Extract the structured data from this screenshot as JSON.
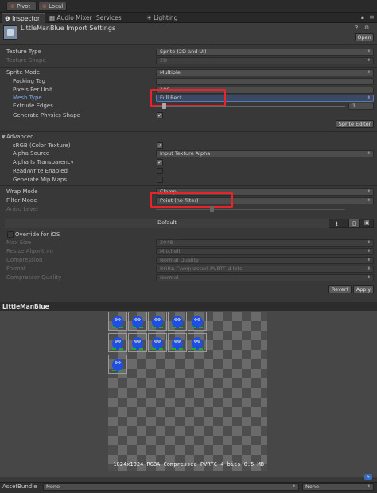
{
  "toolbar": {
    "pivot": "Pivot",
    "local": "Local"
  },
  "tabs": [
    {
      "label": "Inspector",
      "active": true
    },
    {
      "label": "Audio Mixer",
      "active": false
    },
    {
      "label": "Services",
      "active": false
    },
    {
      "label": "Lighting",
      "active": false
    }
  ],
  "header": {
    "title": "LittleManBlue Import Settings",
    "open": "Open"
  },
  "rows": {
    "texture_type": {
      "label": "Texture Type",
      "value": "Sprite (2D and UI)"
    },
    "texture_shape": {
      "label": "Texture Shape",
      "value": "2D"
    },
    "sprite_mode": {
      "label": "Sprite Mode",
      "value": "Multiple"
    },
    "packing_tag": {
      "label": "Packing Tag",
      "value": ""
    },
    "pixels_per_unit": {
      "label": "Pixels Per Unit",
      "value": "100"
    },
    "mesh_type": {
      "label": "Mesh Type",
      "value": "Full Rect"
    },
    "extrude_edges": {
      "label": "Extrude Edges",
      "value": "1"
    },
    "physics_shape": {
      "label": "Generate Physics Shape"
    },
    "sprite_editor": "Sprite Editor",
    "advanced": "Advanced",
    "srgb": {
      "label": "sRGB (Color Texture)"
    },
    "alpha_source": {
      "label": "Alpha Source",
      "value": "Input Texture Alpha"
    },
    "alpha_transparency": {
      "label": "Alpha Is Transparency"
    },
    "read_write": {
      "label": "Read/Write Enabled"
    },
    "mip_maps": {
      "label": "Generate Mip Maps"
    },
    "wrap_mode": {
      "label": "Wrap Mode",
      "value": "Clamp"
    },
    "filter_mode": {
      "label": "Filter Mode",
      "value": "Point (no filter)"
    },
    "aniso": {
      "label": "Aniso Level",
      "value": ""
    }
  },
  "platform": {
    "default": "Default",
    "override": "Override for iOS",
    "max_size": {
      "label": "Max Size",
      "value": "2048"
    },
    "resize": {
      "label": "Resize Algorithm",
      "value": "Mitchell"
    },
    "compression": {
      "label": "Compression",
      "value": "Normal Quality"
    },
    "format": {
      "label": "Format",
      "value": "RGBA Compressed PVRTC 4 bits"
    },
    "compressor": {
      "label": "Compressor Quality",
      "value": "Normal"
    }
  },
  "actions": {
    "revert": "Revert",
    "apply": "Apply"
  },
  "preview": {
    "title": "LittleManBlue",
    "info": "1024x1024  RGBA Compressed PVRTC 4 bits   0.5 MB"
  },
  "asset_bundle": {
    "label": "AssetBundle",
    "name": "None",
    "variant": "None"
  },
  "colors": {
    "highlight": "#e8232a",
    "sprite": "#1f4fe0"
  }
}
